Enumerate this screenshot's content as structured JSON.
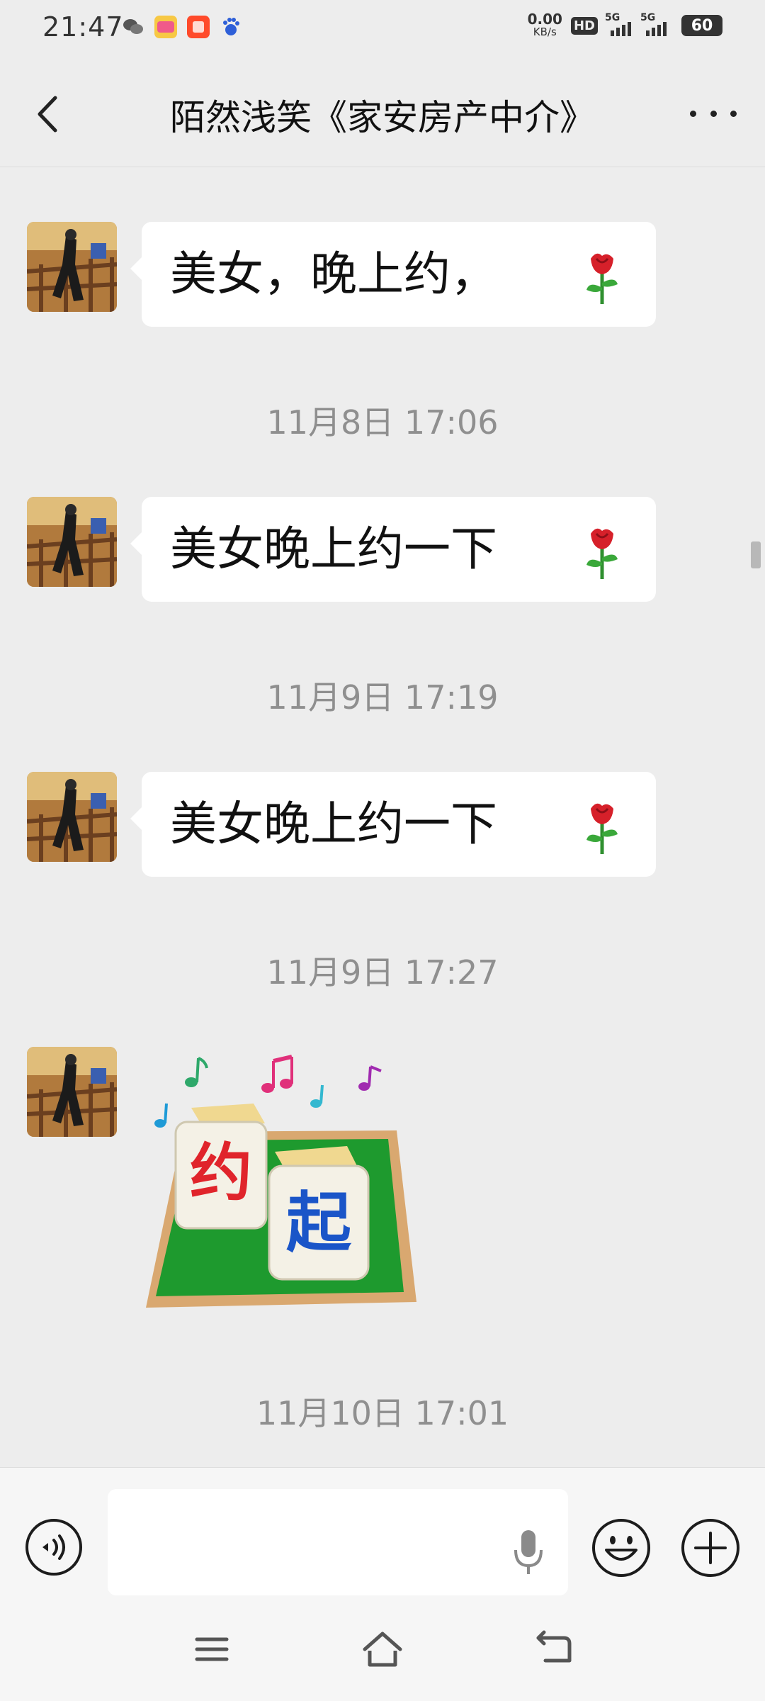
{
  "status_bar": {
    "time": "21:47",
    "net_speed_value": "0.00",
    "net_speed_unit": "KB/s",
    "hd_label": "HD",
    "signal_1_label": "5G",
    "signal_2_label": "5G",
    "battery": "60",
    "app_icons": [
      "wechat-icon",
      "app-icon-1",
      "taobao-icon",
      "baidu-icon"
    ]
  },
  "header": {
    "title": "陌然浅笑《家安房产中介》"
  },
  "messages": [
    {
      "type": "text",
      "text": "美女，晚上约，",
      "emoji": "rose-icon"
    },
    {
      "type": "timestamp",
      "text": "11月8日 17:06"
    },
    {
      "type": "text",
      "text": "美女晚上约一下",
      "emoji": "rose-icon"
    },
    {
      "type": "timestamp",
      "text": "11月9日 17:19"
    },
    {
      "type": "text",
      "text": "美女晚上约一下",
      "emoji": "rose-icon"
    },
    {
      "type": "timestamp",
      "text": "11月9日 17:27"
    },
    {
      "type": "sticker",
      "tile_1": "约",
      "tile_2": "起"
    },
    {
      "type": "timestamp",
      "text": "11月10日 17:01"
    }
  ],
  "input": {
    "value": "",
    "placeholder": ""
  },
  "colors": {
    "background": "#ededed",
    "bubble": "#ffffff",
    "timestamp": "#8f8f8f",
    "sticker_table": "#1e9a2e",
    "tile_text_1": "#e0242b",
    "tile_text_2": "#1a55c8"
  }
}
